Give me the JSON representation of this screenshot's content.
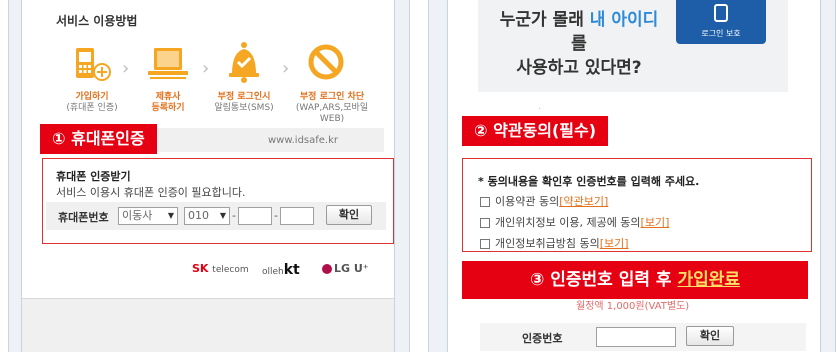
{
  "left": {
    "section_title": "서비스 이용방법",
    "steps": [
      {
        "icon": "phone-plus-icon",
        "line1": "가입하기",
        "line2": "(휴대폰 인증)"
      },
      {
        "icon": "laptop-icon",
        "line1": "제휴사",
        "line2": "등록하기"
      },
      {
        "icon": "bell-check-icon",
        "line1": "부정 로그인시",
        "line2": "알림통보(SMS)"
      },
      {
        "icon": "block-icon",
        "line1": "부정 로그인 차단",
        "line2": "(WAP,ARS,모바일WEB)"
      }
    ],
    "domain": "www.idsafe.kr",
    "callout": "① 휴대폰인증",
    "verify_title": "휴대폰 인증받기",
    "verify_desc": "서비스 이용시 휴대폰 인증이 필요합니다.",
    "phone_label": "휴대폰번호",
    "carrier_value": "이동사",
    "prefix_value": "010",
    "dash": "-",
    "confirm_button": "확인",
    "logos": {
      "sk": "SK",
      "sk_sub": "telecom",
      "kt_pre": "olleh",
      "kt": "kt",
      "lg": "LG U⁺"
    }
  },
  "right": {
    "banner_line1_pre": "누군가 몰래 ",
    "banner_line1_hl": "내 아이디",
    "banner_line1_post": "를",
    "banner_line2": "사용하고 있다면?",
    "shield_label": "로그인 보호",
    "callout_terms": "② 약관동의(필수)",
    "agree_intro": "* 동의내용을 확인후 인증번호를 입력해 주세요.",
    "checks": [
      {
        "label": "이용약관 동의",
        "link": "[약관보기]"
      },
      {
        "label": "개인위치정보 이용, 제공에 동의",
        "link": "[보기]"
      },
      {
        "label": "개인정보취급방침 동의",
        "link": "[보기]"
      }
    ],
    "callout_final_pre": "③ 인증번호 입력 후 ",
    "callout_final_link": "가입완료",
    "price_text": "월정액 1,000원(VAT별도)",
    "cert_label": "인증번호",
    "cert_button": "확인"
  },
  "colors": {
    "accent_red": "#e50012",
    "orange": "#e2711d",
    "blue": "#2e8bd8"
  }
}
